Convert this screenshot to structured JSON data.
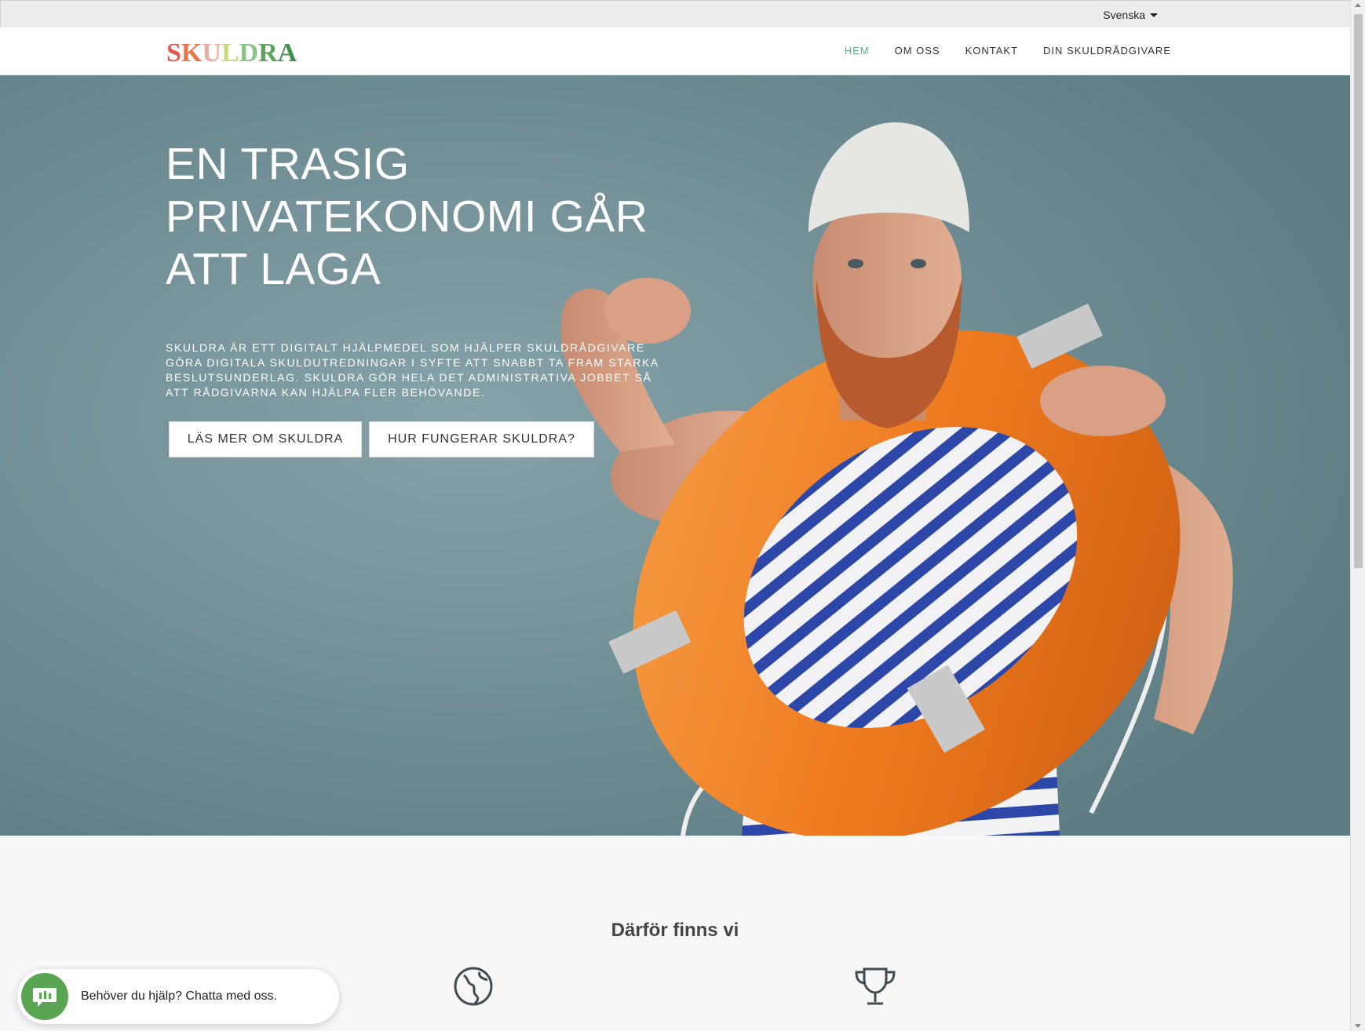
{
  "language": {
    "selected": "Svenska",
    "icon": "caret-down-icon"
  },
  "brand": {
    "letters": [
      "S",
      "K",
      "U",
      "L",
      "D",
      "R",
      "A"
    ],
    "colors": [
      "#e05a4f",
      "#e8744c",
      "#f0a99c",
      "#c9d77f",
      "#8cc38a",
      "#5aa45a",
      "#3f8f4a"
    ]
  },
  "nav": {
    "items": [
      {
        "label": "HEM",
        "active": true
      },
      {
        "label": "OM OSS",
        "active": false
      },
      {
        "label": "KONTAKT",
        "active": false
      },
      {
        "label": "DIN SKULDRÅDGIVARE",
        "active": false
      }
    ],
    "active_color": "#5aaa91"
  },
  "hero": {
    "title": "EN TRASIG PRIVATEKONOMI GÅR ATT LAGA",
    "description": "SKULDRA ÄR ETT DIGITALT HJÄLPMEDEL SOM HJÄLPER SKULDRÅDGIVARE GÖRA DIGITALA SKULDUTREDNINGAR I SYFTE ATT SNABBT TA FRAM STARKA BESLUTSUNDERLAG. SKULDRA GÖR HELA DET ADMINISTRATIVA JOBBET SÅ ATT RÅDGIVARNA KAN HJÄLPA FLER BEHÖVANDE.",
    "button_primary": "LÄS MER OM SKULDRA",
    "button_secondary": "HUR FUNGERAR SKULDRA?",
    "image_subject": "man with beard in swim cap and striped tank top holding orange lifebuoy, flexing arm"
  },
  "why": {
    "title": "Därför finns vi",
    "icons": [
      "globe-icon",
      "trophy-icon"
    ]
  },
  "chat": {
    "text": "Behöver du hjälp? Chatta med oss.",
    "icon": "chat-icon",
    "color": "#5aa552"
  }
}
